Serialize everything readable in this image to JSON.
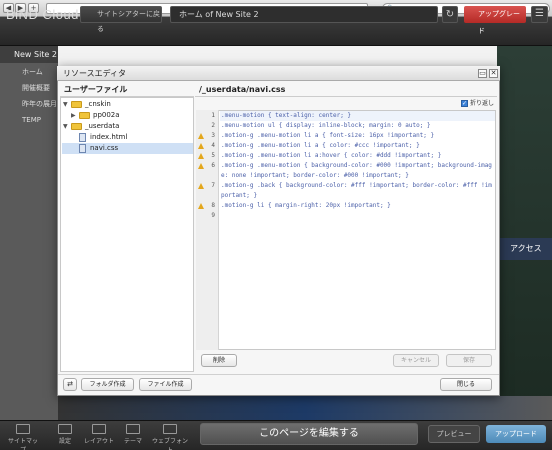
{
  "browser": {
    "back": "◀",
    "forward": "▶",
    "add_tab": "+",
    "search_glyph": "🔍"
  },
  "header": {
    "logo": "BiND Cloud",
    "theater_button": "サイトシアターに戻る",
    "home_title": "ホーム of New Site 2",
    "refresh_glyph": "↻",
    "upgrade_button": "アップグレード",
    "menu_glyph": "☰"
  },
  "sidebar": {
    "site_name": "New Site 2",
    "items": [
      {
        "label": "ホーム"
      },
      {
        "label": "開催概要"
      },
      {
        "label": "昨年の展月"
      },
      {
        "label": "TEMP"
      }
    ]
  },
  "background": {
    "access_label": "アクセス"
  },
  "toolbar": {
    "tools": [
      {
        "label": "サイトマップ"
      },
      {
        "label": "設定"
      },
      {
        "label": "レイアウト"
      },
      {
        "label": "テーマ"
      },
      {
        "label": "ウェブフォント"
      }
    ],
    "edit_button": "このページを編集する",
    "preview_button": "プレビュー",
    "publish_button": "アップロード"
  },
  "dialog": {
    "title": "リソースエディタ",
    "minimize_glyph": "▭",
    "close_glyph": "✕",
    "left_header": "ユーザーファイル",
    "tree": [
      {
        "label": "_cnskin",
        "type": "folder",
        "expanded": true
      },
      {
        "label": "pp002a",
        "type": "folder",
        "expanded": false
      },
      {
        "label": "_userdata",
        "type": "folder",
        "expanded": true
      },
      {
        "label": "index.html",
        "type": "file"
      },
      {
        "label": "navi.css",
        "type": "file",
        "selected": true
      }
    ],
    "file_path": "/_userdata/navi.css",
    "wrap_label": "折り返し",
    "wrap_checked": true,
    "code_lines": [
      {
        "n": "1",
        "warn": false,
        "text": ".menu-motion { text-align: center; }"
      },
      {
        "n": "2",
        "warn": false,
        "text": ".menu-motion ul { display: inline-block; margin: 0 auto; }"
      },
      {
        "n": "3",
        "warn": true,
        "text": ".motion-g .menu-motion li a { font-size: 16px !important; }"
      },
      {
        "n": "4",
        "warn": true,
        "text": ".motion-g .menu-motion li a { color: #ccc !important; }"
      },
      {
        "n": "5",
        "warn": true,
        "text": ".motion-g .menu-motion li a:hover { color: #ddd !important; }"
      },
      {
        "n": "6",
        "warn": true,
        "text": ".motion-g .menu-motion { background-color: #000 !important; background-image: none !important; border-color: #000 !important; }"
      },
      {
        "n": "7",
        "warn": true,
        "text": ".motion-g .back { background-color: #fff !important; border-color: #fff !important; }"
      },
      {
        "n": "8",
        "warn": true,
        "text": ".motion-g li { margin-right: 20px !important; }"
      },
      {
        "n": "9",
        "warn": false,
        "text": ""
      }
    ],
    "delete_button": "削除",
    "cancel_button": "キャンセル",
    "save_button": "保存",
    "sync_glyph": "⇄",
    "new_folder_button": "フォルダ作成",
    "new_file_button": "ファイル作成",
    "close_button": "閉じる"
  }
}
